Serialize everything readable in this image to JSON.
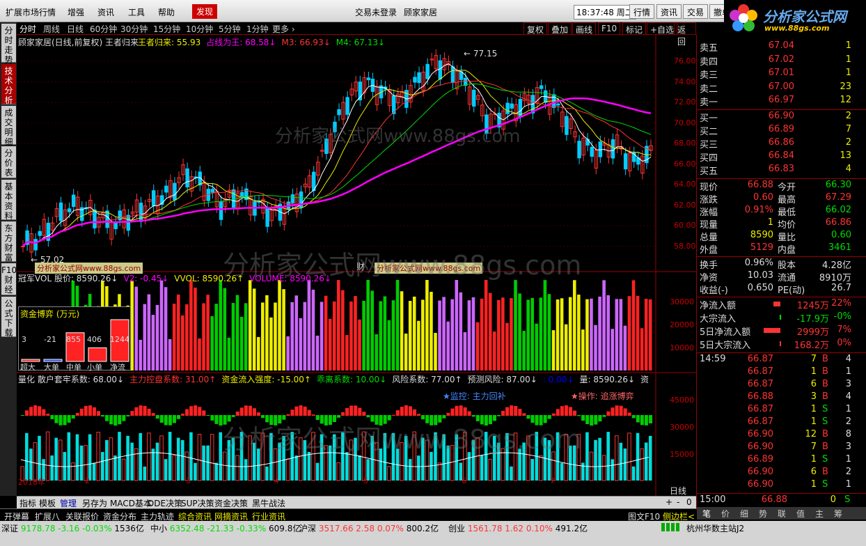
{
  "top": {
    "menu": [
      "扩展市场行情",
      "增强",
      "资讯",
      "工具",
      "帮助"
    ],
    "found": "发现",
    "center_left": "交易未登录",
    "center_right": "顾家家居",
    "time": "18:37:48",
    "weekday": "周二",
    "buttons": [
      "行情",
      "资讯",
      "交易",
      "撤单"
    ]
  },
  "logo": {
    "title": "分析家公式网",
    "url": "www.88gs.com"
  },
  "left_tabs": [
    "分时走势",
    "技术分析",
    "成交明细",
    "分价表",
    "基本资料",
    "东方财富",
    "F10财经",
    "公式下载"
  ],
  "periods": [
    "分时",
    "周线",
    "日线",
    "60分钟",
    "30分钟",
    "15分钟",
    "10分钟",
    "5分钟",
    "1分钟",
    "更多 ›"
  ],
  "period_buttons": [
    "复权",
    "叠加",
    "画线",
    "F10",
    "标记",
    "+自选",
    "返回"
  ],
  "main": {
    "title": "顾家家居(日线,前复权) 王者归来",
    "indicators": [
      {
        "t": "王者归来: 55.93",
        "c": "#ee0"
      },
      {
        "t": "占线为王: 68.58↓",
        "c": "#f0f"
      },
      {
        "t": "M3: 66.93↓",
        "c": "#f33"
      },
      {
        "t": "M4: 67.13↓",
        "c": "#0d0"
      }
    ],
    "high_label": "← 77.15",
    "low_label": "← 57.02",
    "yaxis": [
      "76.00",
      "74.00",
      "72.00",
      "70.00",
      "68.00",
      "66.00",
      "64.00",
      "62.00",
      "60.00",
      "58.00"
    ],
    "fin1": "财",
    "fin2": "财",
    "wm1": "分析家公式网www.88gs.com",
    "wm2": "分析家公式网www.88gs.com"
  },
  "vol": {
    "header": [
      {
        "t": "冠军VOL 股价: 8590.26↓",
        "c": "#ddd"
      },
      {
        "t": "V2: -0.45↓",
        "c": "#f0f"
      },
      {
        "t": "VVOL: 8590.26↑",
        "c": "#ee0"
      },
      {
        "t": "VOLUME: 8590.26↓",
        "c": "#f0f"
      }
    ],
    "yaxis": [
      "30000",
      "20000",
      "10000"
    ]
  },
  "fund": {
    "title": "资金博弈 (万元)",
    "values": [
      "3",
      "-21",
      "855",
      "406",
      "1244"
    ],
    "labels": [
      "超大",
      "大单",
      "中单",
      "小单",
      "净流"
    ]
  },
  "lower": {
    "header": [
      {
        "t": "量化 散户套牢系数: 68.00↓",
        "c": "#ddd"
      },
      {
        "t": "主力控盘系数: 31.00↑",
        "c": "#f33"
      },
      {
        "t": "资金流入强度: -15.00↑",
        "c": "#ee0"
      },
      {
        "t": "乖离系数: 10.00↓",
        "c": "#0d0"
      },
      {
        "t": "风险系数: 77.00↑",
        "c": "#ddd"
      },
      {
        "t": "预测风险: 87.00↓",
        "c": "#ddd"
      },
      {
        "t": ": 0.00↓",
        "c": "#00f"
      },
      {
        "t": "量: 8590.26↓",
        "c": "#ddd"
      },
      {
        "t": "资",
        "c": "#ddd"
      }
    ],
    "monitor": "★监控: 主力回补",
    "action": "★操作: 追涨博弈",
    "yaxis": [
      "45000",
      "30000",
      "15000"
    ],
    "xaxis": [
      "2018年",
      "2",
      "3",
      "4",
      "5",
      "6",
      "7"
    ],
    "period": "日线"
  },
  "bottom_tabs": [
    "指标",
    "模板",
    "管理",
    "另存为",
    "MACD基本",
    "DDE决策",
    "SUP决策",
    "资金决策",
    "黑牛战法"
  ],
  "zoom": [
    "+",
    "-",
    "0"
  ],
  "bottom_bar": [
    "开弹幕",
    "扩展八",
    "关联报价",
    "资金分布",
    "主力轨迹",
    "综合资讯",
    "网摘资讯",
    "行业资讯"
  ],
  "bottom_right": [
    "图文F10",
    "侧边栏<"
  ],
  "right_tabs": [
    "笔",
    "价",
    "细",
    "势",
    "联",
    "值",
    "主",
    "筹"
  ],
  "orderbook": {
    "sell": [
      {
        "k": "卖五",
        "p": "67.04",
        "q": "1"
      },
      {
        "k": "卖四",
        "p": "67.02",
        "q": "1"
      },
      {
        "k": "卖三",
        "p": "67.01",
        "q": "1"
      },
      {
        "k": "卖二",
        "p": "67.00",
        "q": "23"
      },
      {
        "k": "卖一",
        "p": "66.97",
        "q": "12"
      }
    ],
    "buy": [
      {
        "k": "买一",
        "p": "66.90",
        "q": "2"
      },
      {
        "k": "买二",
        "p": "66.89",
        "q": "7"
      },
      {
        "k": "买三",
        "p": "66.86",
        "q": "2"
      },
      {
        "k": "买四",
        "p": "66.84",
        "q": "13"
      },
      {
        "k": "买五",
        "p": "66.83",
        "q": "4"
      }
    ]
  },
  "quote": [
    {
      "k1": "现价",
      "v1": "66.88",
      "c1": "#f33",
      "k2": "今开",
      "v2": "66.30",
      "c2": "#0d0"
    },
    {
      "k1": "涨跌",
      "v1": "0.60",
      "c1": "#f33",
      "k2": "最高",
      "v2": "67.29",
      "c2": "#f33"
    },
    {
      "k1": "涨幅",
      "v1": "0.91%",
      "c1": "#f33",
      "k2": "最低",
      "v2": "66.02",
      "c2": "#0d0"
    },
    {
      "k1": "现量",
      "v1": "1",
      "c1": "#ee0",
      "k2": "均价",
      "v2": "66.86",
      "c2": "#f33"
    },
    {
      "k1": "总量",
      "v1": "8590",
      "c1": "#ee0",
      "k2": "量比",
      "v2": "0.60",
      "c2": "#0d0"
    },
    {
      "k1": "外盘",
      "v1": "5129",
      "c1": "#f33",
      "k2": "内盘",
      "v2": "3461",
      "c2": "#0d0"
    }
  ],
  "quote2": [
    {
      "k1": "换手",
      "v1": "0.96%",
      "c1": "#ddd",
      "k2": "股本",
      "v2": "4.28亿",
      "c2": "#ddd"
    },
    {
      "k1": "净资",
      "v1": "10.03",
      "c1": "#ddd",
      "k2": "流通",
      "v2": "8910万",
      "c2": "#ddd"
    },
    {
      "k1": "收益(-)",
      "v1": "0.650",
      "c1": "#ddd",
      "k2": "PE(动)",
      "v2": "26.7",
      "c2": "#ddd"
    }
  ],
  "flows": [
    {
      "k": "净流入额",
      "v": "1245万",
      "p": "22%",
      "c": "#f33",
      "bar": 0.35
    },
    {
      "k": "大宗流入",
      "v": "-17.9万",
      "p": "-0%",
      "c": "#0d0",
      "bar": 0.05
    },
    {
      "k": "5日净流入额",
      "v": "2999万",
      "p": "7%",
      "c": "#f33",
      "bar": 0.8
    },
    {
      "k": "5日大宗流入",
      "v": "168.2万",
      "p": "0%",
      "c": "#f33",
      "bar": 0.02
    }
  ],
  "ticks_time": "14:59",
  "ticks": [
    {
      "p": "66.87",
      "q": "7",
      "s": "B",
      "n": "4"
    },
    {
      "p": "66.87",
      "q": "1",
      "s": "B",
      "n": "1"
    },
    {
      "p": "66.87",
      "q": "6",
      "s": "B",
      "n": "3"
    },
    {
      "p": "66.88",
      "q": "3",
      "s": "B",
      "n": "4"
    },
    {
      "p": "66.87",
      "q": "1",
      "s": "S",
      "n": "1"
    },
    {
      "p": "66.87",
      "q": "1",
      "s": "S",
      "n": "2"
    },
    {
      "p": "66.90",
      "q": "12",
      "s": "B",
      "n": "8"
    },
    {
      "p": "66.90",
      "q": "7",
      "s": "B",
      "n": "3"
    },
    {
      "p": "66.89",
      "q": "1",
      "s": "S",
      "n": "1"
    },
    {
      "p": "66.90",
      "q": "6",
      "s": "B",
      "n": "2"
    },
    {
      "p": "66.90",
      "q": "1",
      "s": "S",
      "n": "1"
    }
  ],
  "close_row": {
    "t": "15:00",
    "p": "66.88",
    "q": "0",
    "s": "S"
  },
  "status": {
    "items": [
      {
        "n": "深证",
        "v": "9178.78",
        "d": "-3.16",
        "pc": "-0.03%",
        "a": "1536亿",
        "c": "#0d0"
      },
      {
        "n": "中小",
        "v": "6352.48",
        "d": "-21.33",
        "pc": "-0.33%",
        "a": "609.8亿",
        "c": "#0d0"
      },
      {
        "n": "沪深",
        "v": "3517.66",
        "d": "2.58",
        "pc": "0.07%",
        "a": "800.2亿",
        "c": "#f33"
      },
      {
        "n": "创业",
        "v": "1561.78",
        "d": "1.62",
        "pc": "0.10%",
        "a": "491.2亿",
        "c": "#f33"
      }
    ],
    "server": "杭州华数主站J2"
  }
}
